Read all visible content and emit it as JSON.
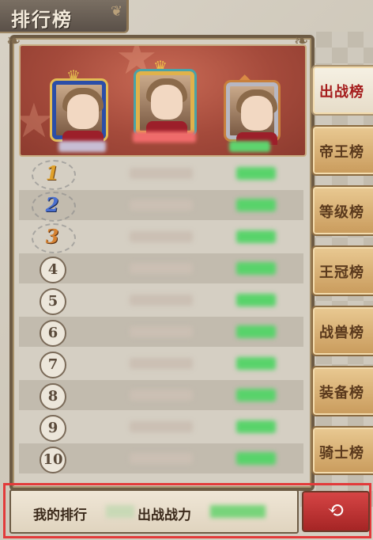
{
  "title": "排行榜",
  "tabs": [
    {
      "label": "出战榜",
      "active": true
    },
    {
      "label": "帝王榜",
      "active": false
    },
    {
      "label": "等级榜",
      "active": false
    },
    {
      "label": "王冠榜",
      "active": false
    },
    {
      "label": "战兽榜",
      "active": false
    },
    {
      "label": "装备榜",
      "active": false
    },
    {
      "label": "骑士榜",
      "active": false
    }
  ],
  "ranks": [
    "1",
    "2",
    "3",
    "4",
    "5",
    "6",
    "7",
    "8",
    "9",
    "10"
  ],
  "bottom": {
    "my_rank_label": "我的排行",
    "power_label": "出战战力"
  },
  "back_icon": "back-arrow-icon",
  "colors": {
    "accent": "#a51d1d",
    "power": "#58d36a",
    "podium": "#a44a3b",
    "tab": "#e9c992"
  }
}
